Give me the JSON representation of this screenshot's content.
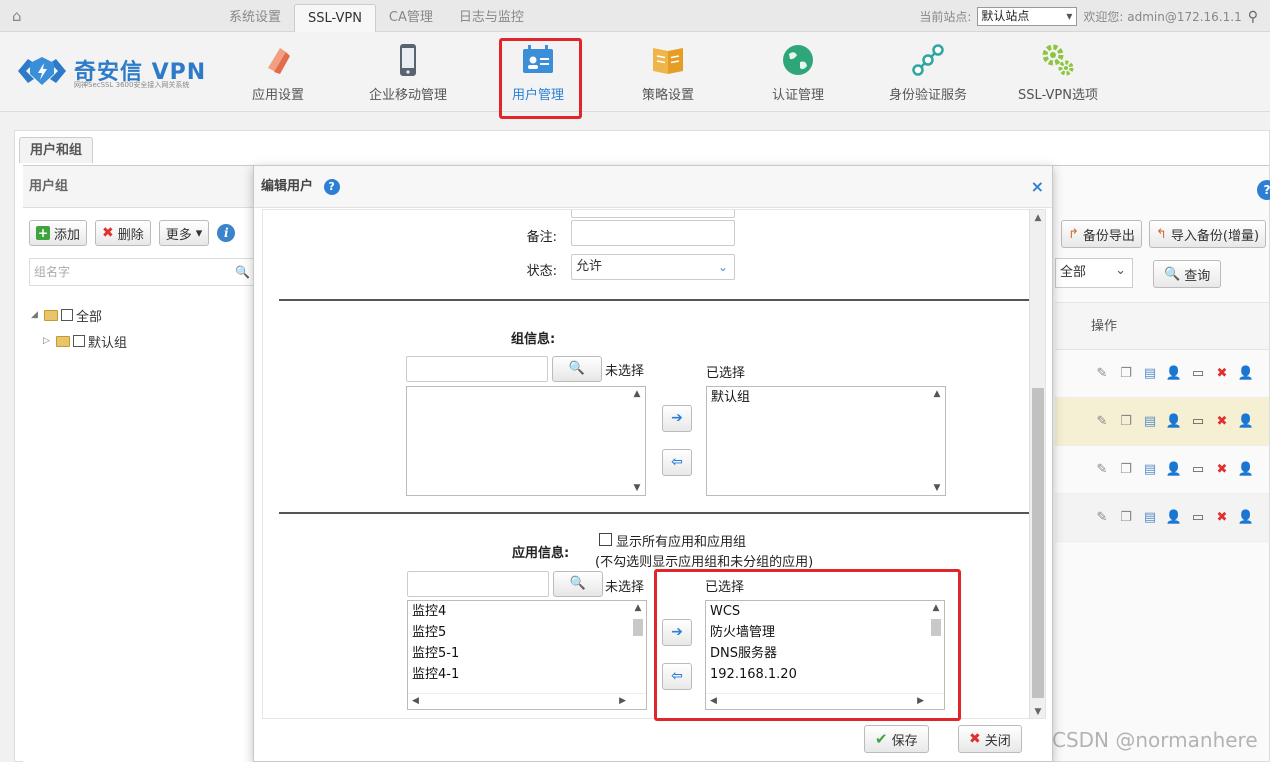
{
  "topnav": {
    "tabs": [
      "系统设置",
      "SSL-VPN",
      "CA管理",
      "日志与监控"
    ],
    "active_tab": "SSL-VPN",
    "site_label": "当前站点:",
    "site_value": "默认站点",
    "welcome": "欢迎您: admin@172.16.1.1"
  },
  "header": {
    "logo_text": "奇安信 VPN",
    "logo_sub": "网神SecSSL 3600安全接入网关系统",
    "modules": [
      {
        "label": "应用设置",
        "icon": "app-settings-icon"
      },
      {
        "label": "企业移动管理",
        "icon": "mobile-phone-icon"
      },
      {
        "label": "用户管理",
        "icon": "user-card-icon"
      },
      {
        "label": "策略设置",
        "icon": "policy-book-icon"
      },
      {
        "label": "认证管理",
        "icon": "globe-icon"
      },
      {
        "label": "身份验证服务",
        "icon": "nodes-icon"
      },
      {
        "label": "SSL-VPN选项",
        "icon": "gears-icon"
      }
    ],
    "active_module": "用户管理"
  },
  "content": {
    "tab_label": "用户和组",
    "left": {
      "title": "用户组",
      "add_label": "添加",
      "delete_label": "删除",
      "more_label": "更多",
      "search_placeholder": "组名字",
      "tree": [
        {
          "label": "全部",
          "level": 0
        },
        {
          "label": "默认组",
          "level": 1
        }
      ]
    },
    "right": {
      "backup_export": "备份导出",
      "import_backup": "导入备份(增量)",
      "filter_value": "全部",
      "query_label": "查询",
      "op_header": "操作"
    }
  },
  "dialog": {
    "title": "编辑用户",
    "remark_label": "备注:",
    "remark_value": "",
    "status_label": "状态:",
    "status_value": "允许",
    "group_info_label": "组信息:",
    "unselected_label": "未选择",
    "selected_label": "已选择",
    "group_selected": [
      "默认组"
    ],
    "group_unselected": [],
    "app_info_label": "应用信息:",
    "show_all_label": "显示所有应用和应用组",
    "show_all_note": "(不勾选则显示应用组和未分组的应用)",
    "app_unselected": [
      "监控4",
      "监控5",
      "监控5-1",
      "监控4-1"
    ],
    "app_selected": [
      "WCS",
      "防火墙管理",
      "DNS服务器",
      "192.168.1.20"
    ],
    "save_label": "保存",
    "close_label": "关闭"
  },
  "watermark": "CSDN @normanhere",
  "colors": {
    "accent": "#2c7fd4",
    "highlight_box": "#e0262b",
    "selected_row": "#f5efd3"
  }
}
